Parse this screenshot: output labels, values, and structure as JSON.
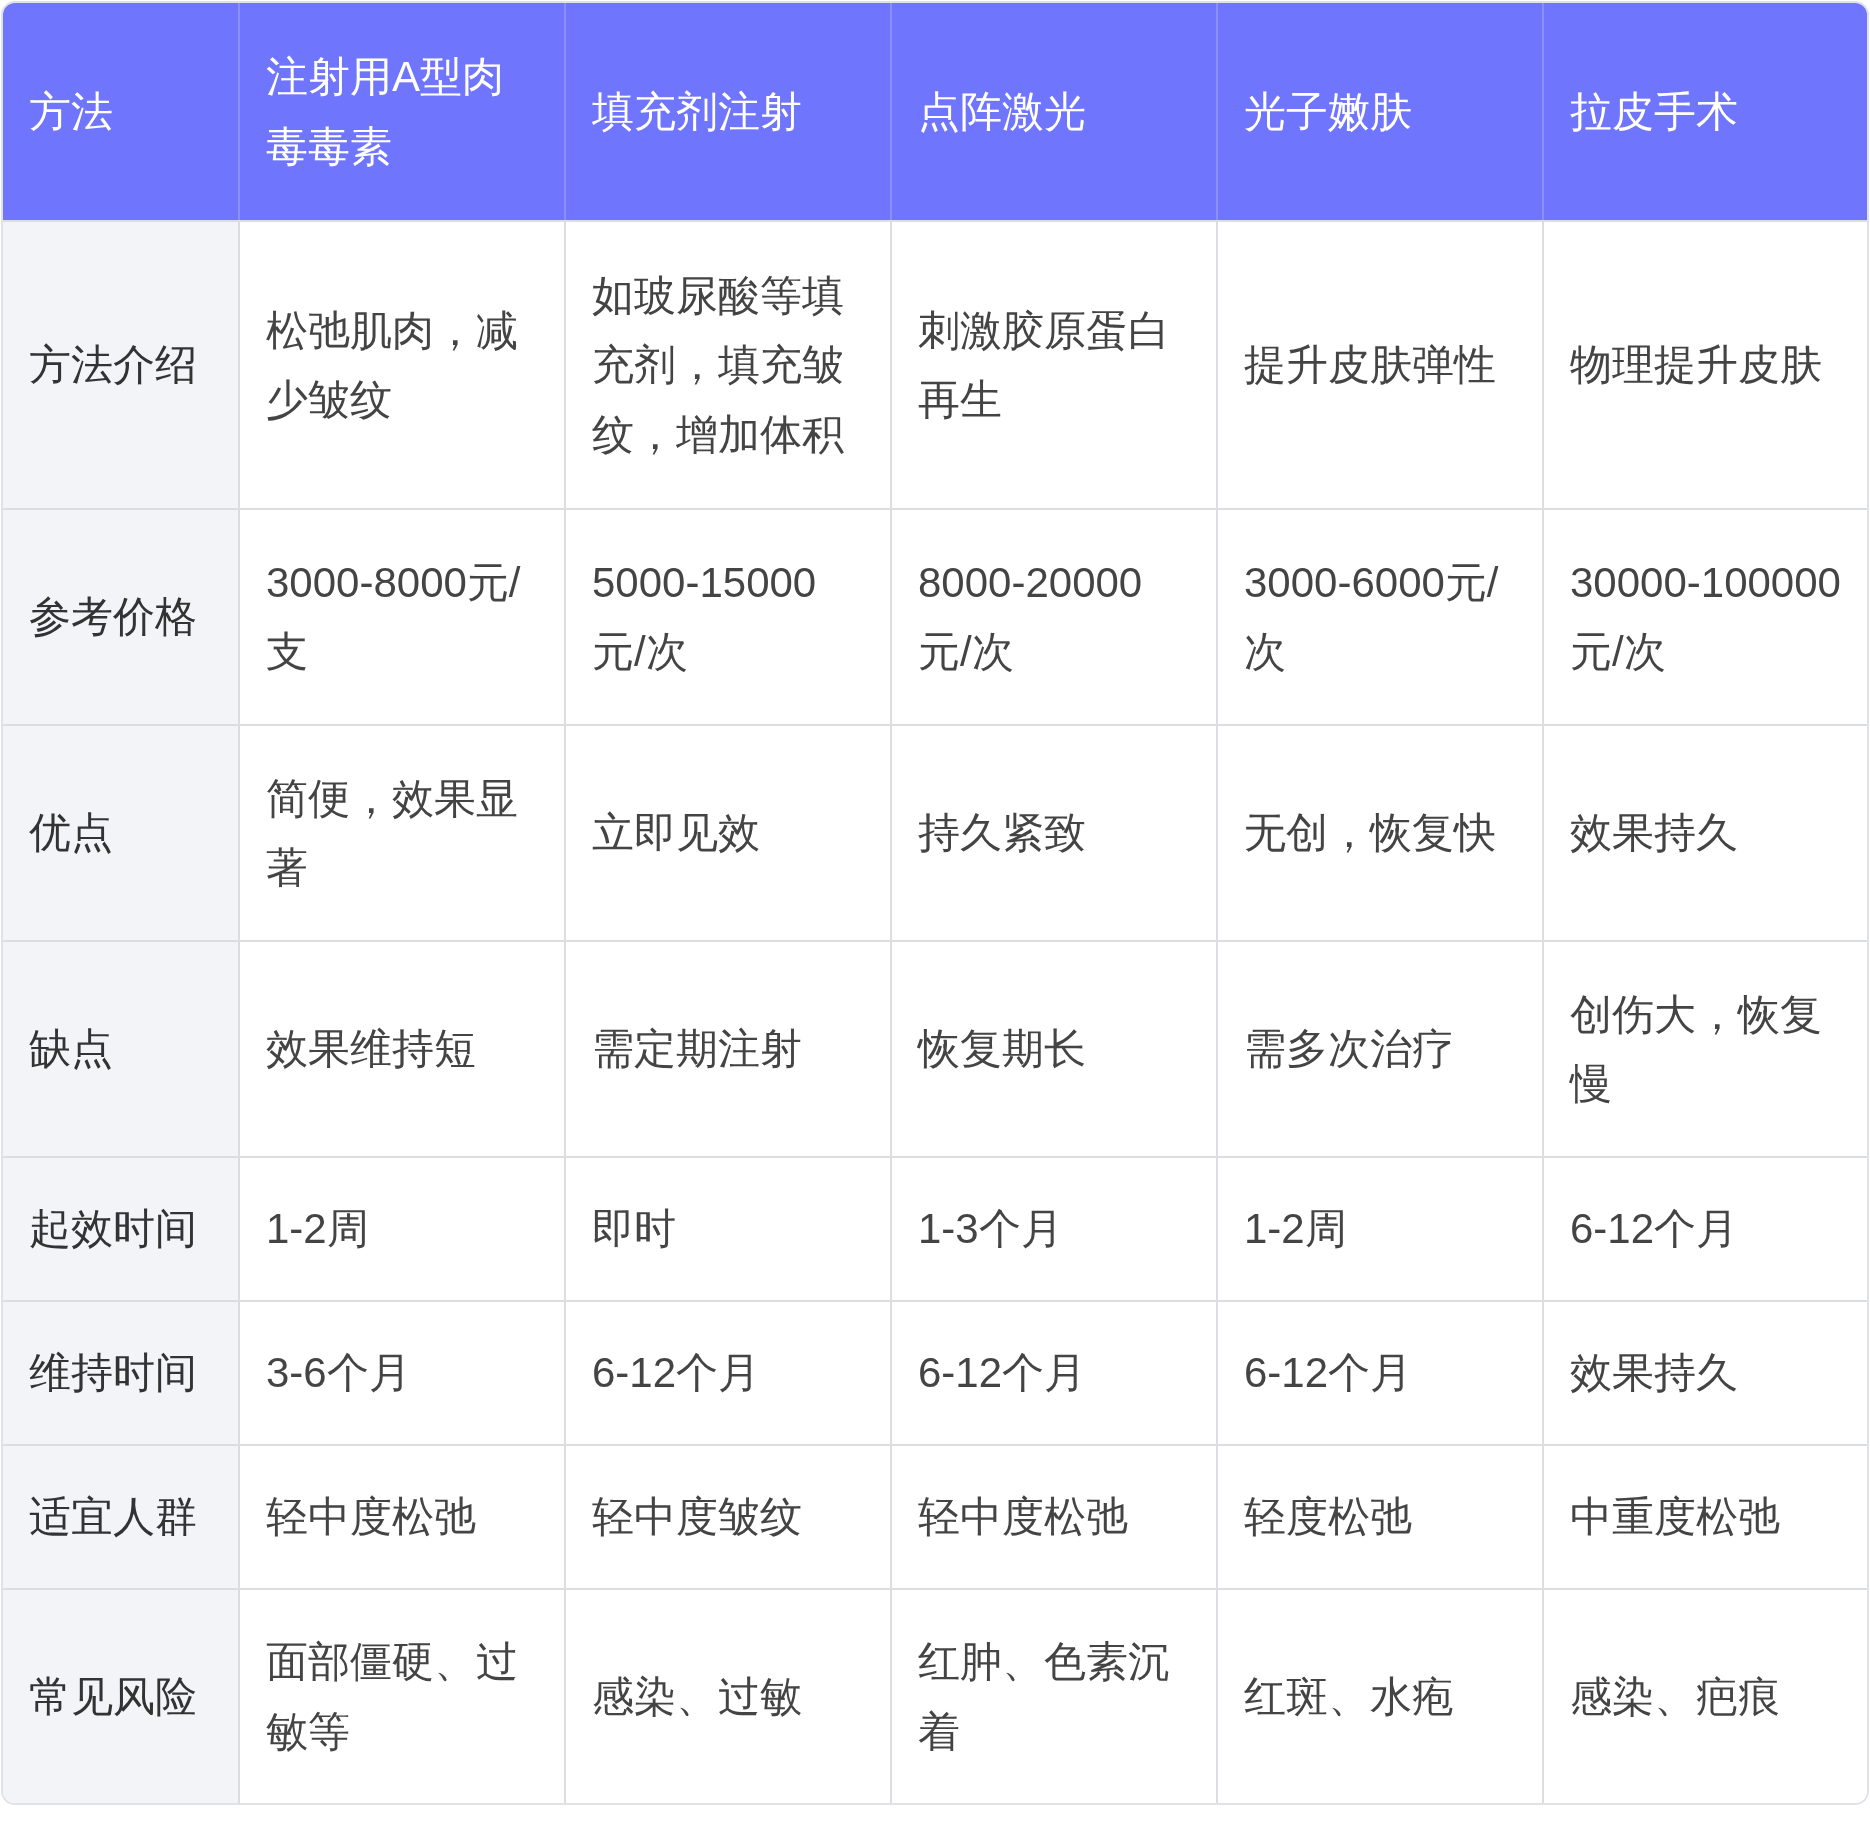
{
  "table": {
    "columns": [
      "方法",
      "注射用A型肉毒毒素",
      "填充剂注射",
      "点阵激光",
      "光子嫩肤",
      "拉皮手术"
    ],
    "rows": [
      [
        "方法介绍",
        "松弛肌肉，减少皱纹",
        "如玻尿酸等填充剂，填充皱纹，增加体积",
        "刺激胶原蛋白再生",
        "提升皮肤弹性",
        "物理提升皮肤"
      ],
      [
        "参考价格",
        "3000-8000元/支",
        "5000-15000元/次",
        "8000-20000元/次",
        "3000-6000元/次",
        "30000-100000元/次"
      ],
      [
        "优点",
        "简便，效果显著",
        "立即见效",
        "持久紧致",
        "无创，恢复快",
        "效果持久"
      ],
      [
        "缺点",
        "效果维持短",
        "需定期注射",
        "恢复期长",
        "需多次治疗",
        "创伤大，恢复慢"
      ],
      [
        "起效时间",
        "1-2周",
        "即时",
        "1-3个月",
        "1-2周",
        "6-12个月"
      ],
      [
        "维持时间",
        "3-6个月",
        "6-12个月",
        "6-12个月",
        "6-12个月",
        "效果持久"
      ],
      [
        "适宜人群",
        "轻中度松弛",
        "轻中度皱纹",
        "轻中度松弛",
        "轻度松弛",
        "中重度松弛"
      ],
      [
        "常见风险",
        "面部僵硬、过敏等",
        "感染、过敏",
        "红肿、色素沉着",
        "红斑、水疱",
        "感染、疤痕"
      ]
    ]
  }
}
